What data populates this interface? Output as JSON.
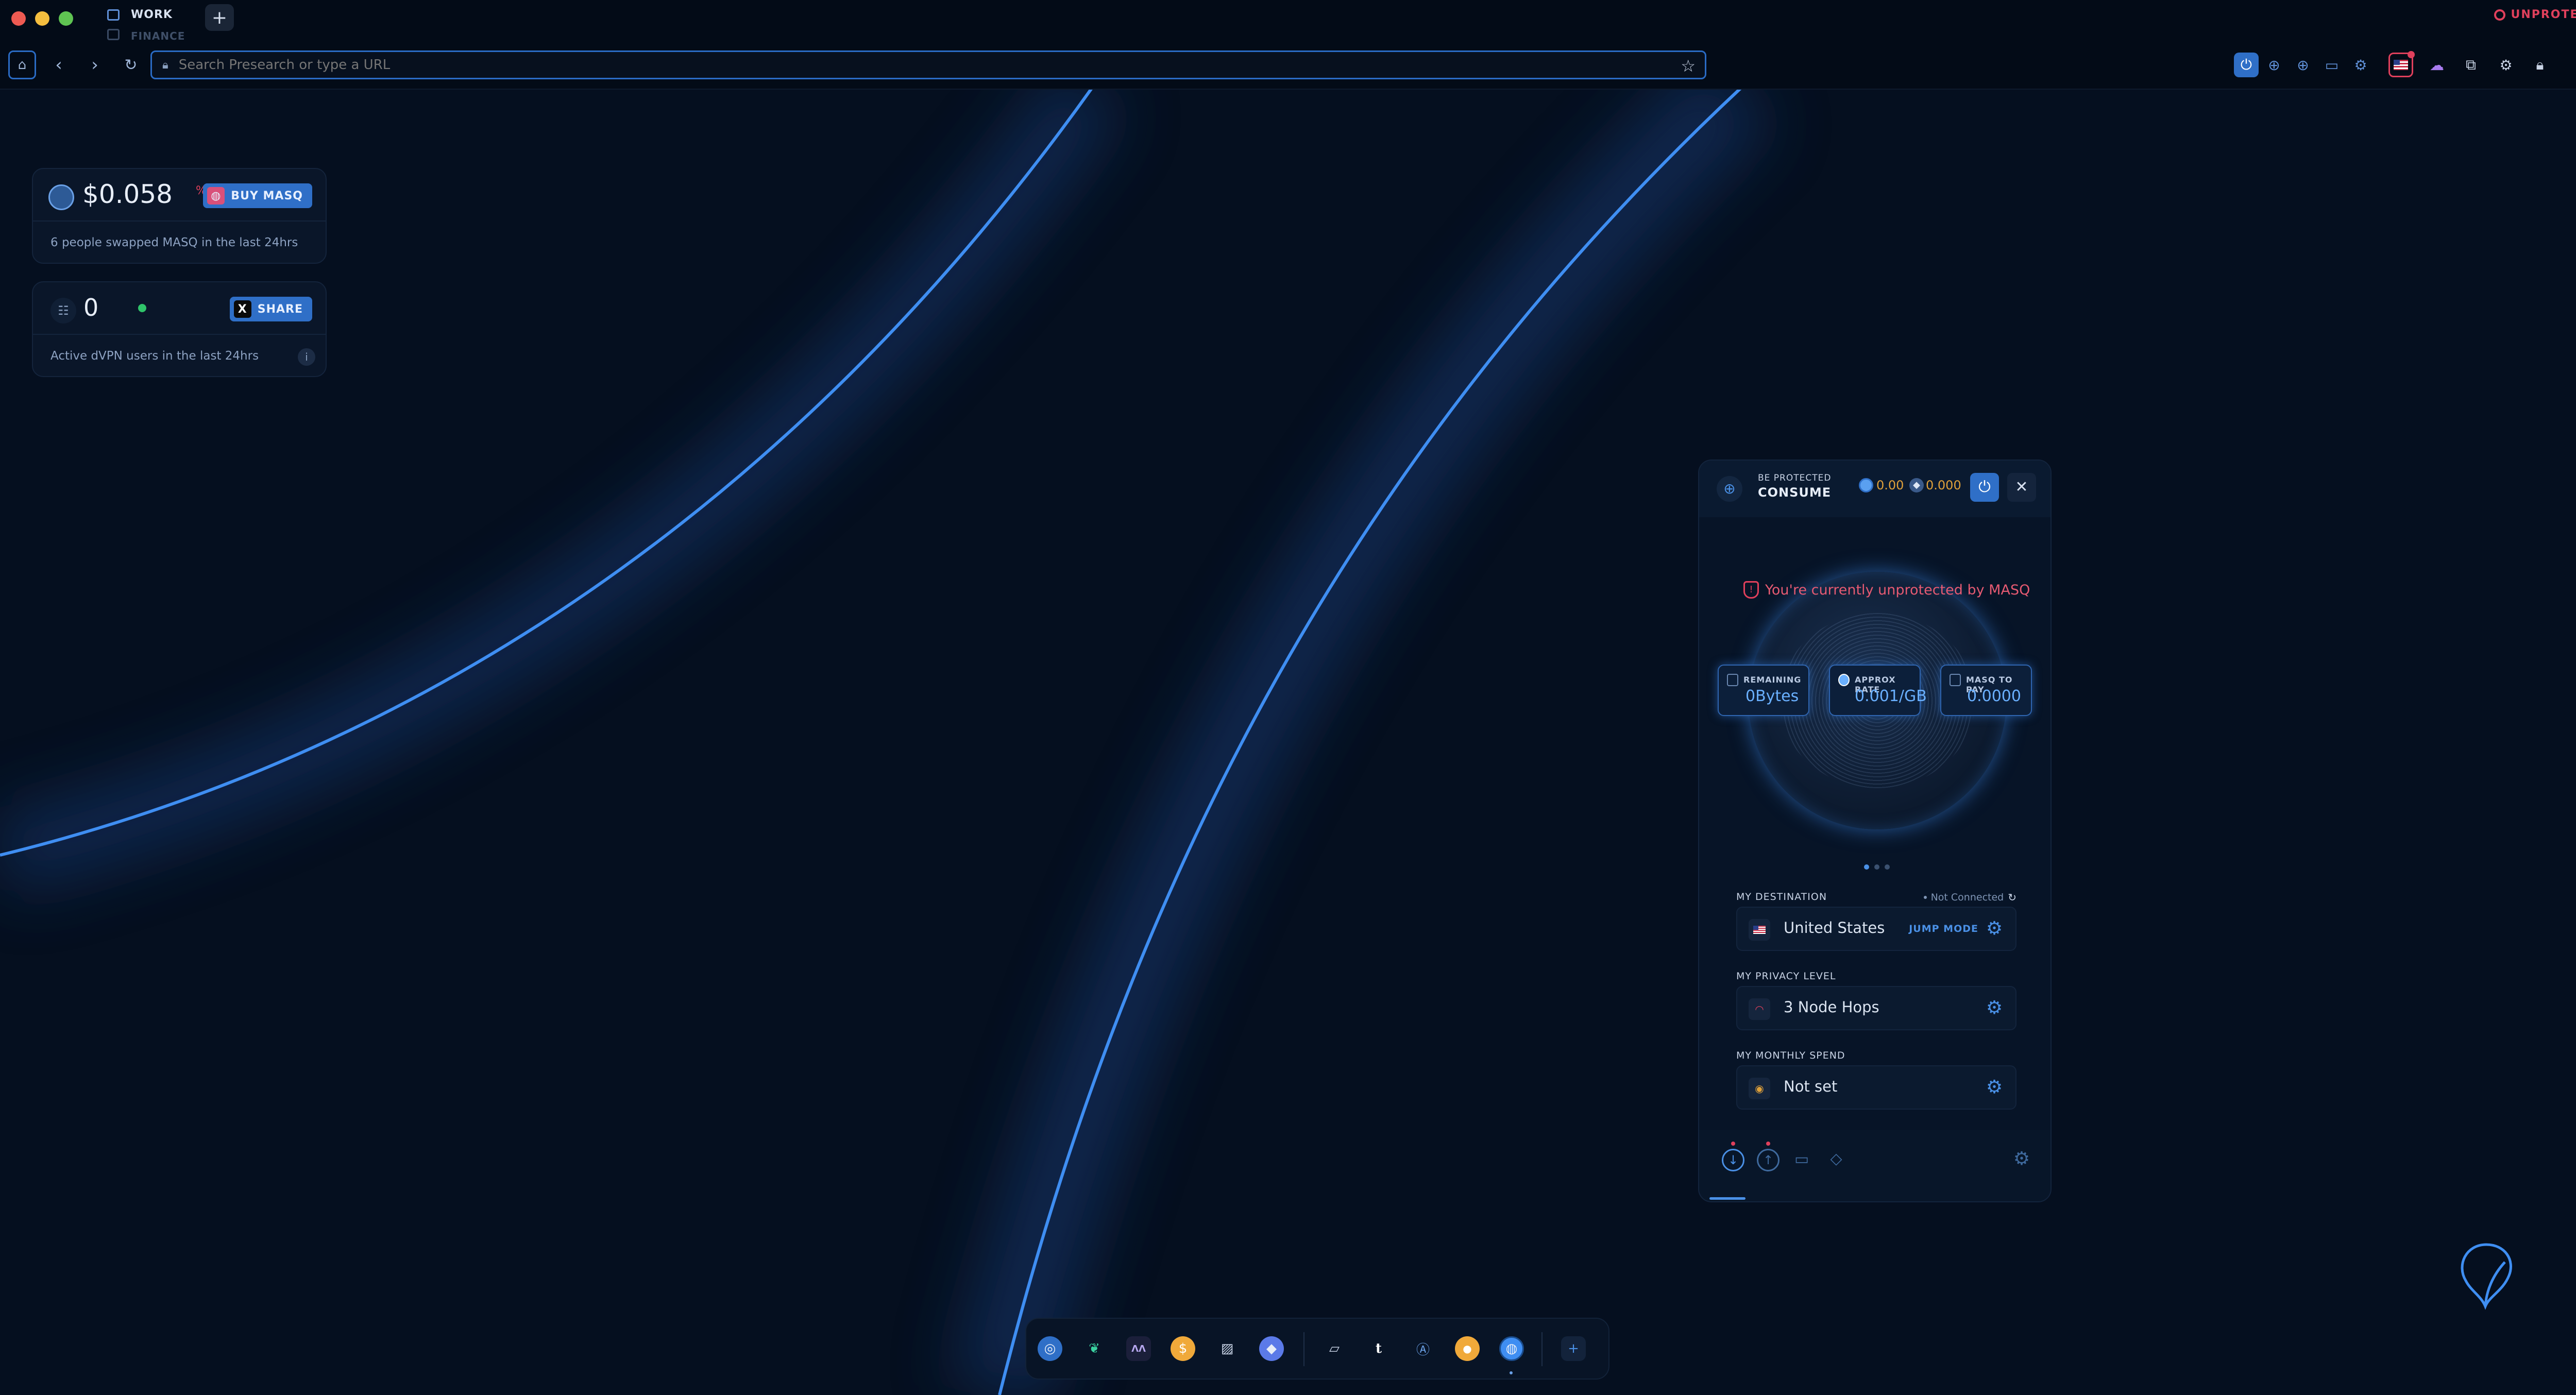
{
  "window": {
    "tabs": [
      {
        "label": "WORK",
        "active": true
      },
      {
        "label": "FINANCE",
        "active": false
      }
    ],
    "new_tab_label": "+",
    "status": "UNPROTECTED"
  },
  "toolbar": {
    "url_placeholder": "Search Presearch or type a URL"
  },
  "widgets": {
    "price": {
      "value": "$0.058",
      "change": "%",
      "button": "BUY MASQ",
      "caption": "6 people swapped MASQ in the last 24hrs"
    },
    "users": {
      "count": "0",
      "button": "SHARE",
      "caption": "Active dVPN users in the last 24hrs"
    }
  },
  "vpn": {
    "header": {
      "small": "BE PROTECTED",
      "mode": "CONSUME",
      "balance_masq": "0.00",
      "balance_eth": "0.000"
    },
    "warning": "You're currently unprotected by MASQ",
    "stats": [
      {
        "title": "REMAINING",
        "value": "0Bytes"
      },
      {
        "title": "APPROX RATE",
        "value": "0.001/GB"
      },
      {
        "title": "MASQ TO PAY",
        "value": "0.0000"
      }
    ],
    "destination": {
      "label": "MY DESTINATION",
      "status": "Not Connected",
      "value": "United States",
      "jump": "JUMP MODE"
    },
    "privacy": {
      "label": "MY PRIVACY LEVEL",
      "value": "3 Node Hops"
    },
    "spend": {
      "label": "MY MONTHLY SPEND",
      "value": "Not set"
    }
  },
  "dock": {
    "add_label": "+",
    "tumblr_glyph": "t"
  },
  "colors": {
    "background": "#050f1f",
    "accent": "#2f6fc7",
    "danger": "#e0405c",
    "amber": "#e0a13a"
  }
}
